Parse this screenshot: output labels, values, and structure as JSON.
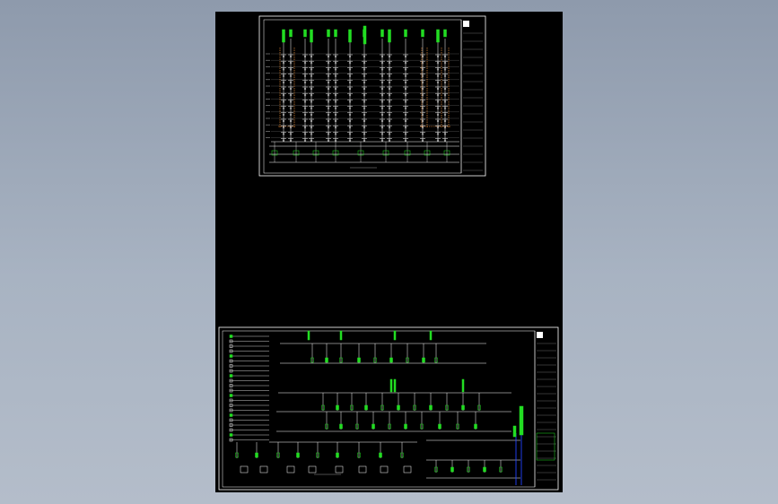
{
  "viewer": {
    "background_top": "#8e9aac",
    "background_bottom": "#b4bdca",
    "canvas_color": "#000000"
  },
  "drawing": {
    "sheets": [
      {
        "id": "upper-sheet",
        "kind": "riser-diagram"
      },
      {
        "id": "lower-sheet",
        "kind": "system-diagram"
      }
    ],
    "colors": {
      "frame": "#ffffff",
      "pipe": "#ffffff",
      "riser": "#22dd22",
      "accent": "#ff9a3c",
      "dim_text": "#9a9a9a",
      "highlight": "#2244ff"
    }
  }
}
